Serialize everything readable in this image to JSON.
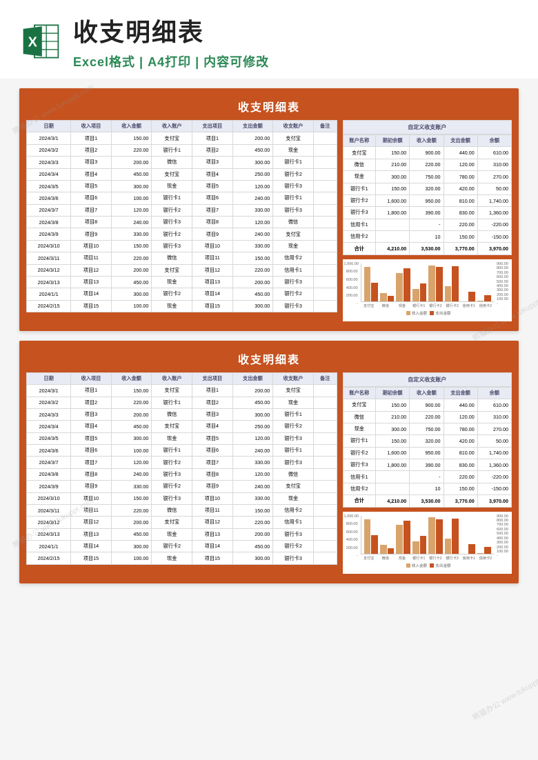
{
  "header": {
    "title": "收支明细表",
    "subtitle": "Excel格式 | A4打印 | 内容可修改"
  },
  "watermark": "熊猫办公 www.tukuppt.com",
  "sheet": {
    "title": "收支明细表",
    "main_headers": [
      "日期",
      "收入项目",
      "收入金额",
      "收入账户",
      "支出项目",
      "支出金额",
      "收支账户",
      "备注"
    ],
    "rows": [
      [
        "2024/3/1",
        "项目1",
        "150.00",
        "支付宝",
        "项目1",
        "200.00",
        "支付宝",
        ""
      ],
      [
        "2024/3/2",
        "项目2",
        "220.00",
        "银行卡1",
        "项目2",
        "450.00",
        "现金",
        ""
      ],
      [
        "2024/3/3",
        "项目3",
        "200.00",
        "微信",
        "项目3",
        "300.00",
        "银行卡1",
        ""
      ],
      [
        "2024/3/4",
        "项目4",
        "450.00",
        "支付宝",
        "项目4",
        "250.00",
        "银行卡2",
        ""
      ],
      [
        "2024/3/5",
        "项目5",
        "300.00",
        "现金",
        "项目5",
        "120.00",
        "银行卡3",
        ""
      ],
      [
        "2024/3/6",
        "项目6",
        "100.00",
        "银行卡1",
        "项目6",
        "240.00",
        "银行卡1",
        ""
      ],
      [
        "2024/3/7",
        "项目7",
        "120.00",
        "银行卡2",
        "项目7",
        "330.00",
        "银行卡3",
        ""
      ],
      [
        "2024/3/8",
        "项目8",
        "240.00",
        "银行卡3",
        "项目8",
        "120.00",
        "微信",
        ""
      ],
      [
        "2024/3/9",
        "项目9",
        "330.00",
        "银行卡2",
        "项目9",
        "240.00",
        "支付宝",
        ""
      ],
      [
        "2024/3/10",
        "项目10",
        "150.00",
        "银行卡3",
        "项目10",
        "330.00",
        "现金",
        ""
      ],
      [
        "2024/3/11",
        "项目11",
        "220.00",
        "微信",
        "项目11",
        "150.00",
        "信用卡2",
        ""
      ],
      [
        "2024/3/12",
        "项目12",
        "200.00",
        "支付宝",
        "项目12",
        "220.00",
        "信用卡1",
        ""
      ],
      [
        "2024/3/13",
        "项目13",
        "450.00",
        "现金",
        "项目13",
        "200.00",
        "银行卡3",
        ""
      ],
      [
        "2024/1/1",
        "项目14",
        "300.00",
        "银行卡2",
        "项目14",
        "450.00",
        "银行卡2",
        ""
      ],
      [
        "2024/2/15",
        "项目15",
        "100.00",
        "现金",
        "项目15",
        "300.00",
        "银行卡3",
        ""
      ]
    ],
    "summary_title": "自定义收支账户",
    "summary_headers": [
      "账户名称",
      "期初余额",
      "收入金额",
      "支出金额",
      "余额"
    ],
    "summary_rows": [
      [
        "支付宝",
        "150.00",
        "900.00",
        "440.00",
        "610.00"
      ],
      [
        "微信",
        "210.00",
        "220.00",
        "120.00",
        "310.00"
      ],
      [
        "现金",
        "300.00",
        "750.00",
        "780.00",
        "270.00"
      ],
      [
        "银行卡1",
        "150.00",
        "320.00",
        "420.00",
        "50.00"
      ],
      [
        "银行卡2",
        "1,600.00",
        "950.00",
        "810.00",
        "1,740.00"
      ],
      [
        "银行卡3",
        "1,800.00",
        "390.00",
        "830.00",
        "1,360.00"
      ],
      [
        "信用卡1",
        "",
        "-",
        "220.00",
        "-220.00"
      ],
      [
        "信用卡2",
        "",
        "10",
        "150.00",
        "-150.00"
      ]
    ],
    "summary_total": [
      "合计",
      "4,210.00",
      "3,530.00",
      "3,770.00",
      "3,970.00"
    ]
  },
  "chart_data": {
    "type": "bar",
    "categories": [
      "支付宝",
      "微信",
      "现金",
      "银行卡1",
      "银行卡2",
      "银行卡3",
      "信用卡1",
      "信用卡2"
    ],
    "series": [
      {
        "name": "收入金额",
        "values": [
          900,
          220,
          750,
          320,
          950,
          390,
          0,
          10
        ]
      },
      {
        "name": "支出金额",
        "values": [
          440,
          120,
          780,
          420,
          810,
          830,
          220,
          150
        ]
      }
    ],
    "ylim_left": [
      0,
      1000
    ],
    "yticks_left": [
      "1,000.00",
      "800.00",
      "600.00",
      "400.00",
      "200.00",
      "-"
    ],
    "ylim_right": [
      0,
      900
    ],
    "yticks_right": [
      "900.00",
      "800.00",
      "700.00",
      "600.00",
      "500.00",
      "400.00",
      "300.00",
      "200.00",
      "100.00",
      "-"
    ],
    "legend": [
      "收入金额",
      "支出金额"
    ],
    "colors": {
      "s1": "#d9a36c",
      "s2": "#c5521f"
    }
  }
}
